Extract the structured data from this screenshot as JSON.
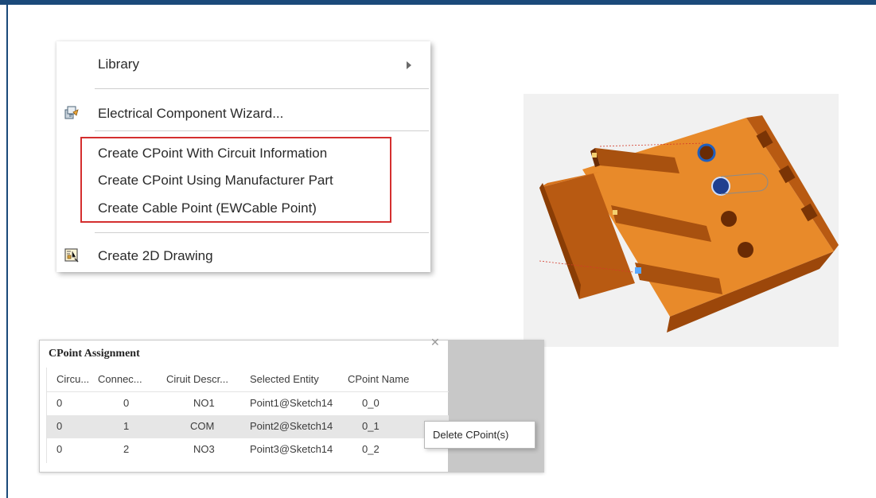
{
  "menu": {
    "items": [
      {
        "label": "Library",
        "has_submenu": true
      },
      {
        "label": "Electrical Component Wizard...",
        "icon": "electrical-wizard-icon"
      },
      {
        "label": "Create CPoint With Circuit Information"
      },
      {
        "label": "Create CPoint  Using Manufacturer Part"
      },
      {
        "label": "Create Cable Point (EWCable Point)"
      },
      {
        "label": "Create 2D Drawing",
        "icon": "drawing-icon"
      }
    ],
    "highlight_color": "#d42f2f"
  },
  "dialog": {
    "title": "CPoint Assignment",
    "columns": [
      "Circu...",
      "Connec...",
      "Ciruit Descr...",
      "Selected Entity",
      "CPoint Name"
    ],
    "rows": [
      {
        "circuit": "0",
        "connector": "0",
        "description": "NO1",
        "entity": "Point1@Sketch14",
        "cpoint": "0_0"
      },
      {
        "circuit": "0",
        "connector": "1",
        "description": "COM",
        "entity": "Point2@Sketch14",
        "cpoint": "0_1"
      },
      {
        "circuit": "0",
        "connector": "2",
        "description": "NO3",
        "entity": "Point3@Sketch14",
        "cpoint": "0_2"
      }
    ]
  },
  "context_popup": {
    "label": "Delete CPoint(s)"
  },
  "colors": {
    "frame": "#1b4a7a",
    "model_body": "#e07a1f",
    "model_dark": "#8a3d05",
    "point_blue": "#1f5fbf"
  }
}
